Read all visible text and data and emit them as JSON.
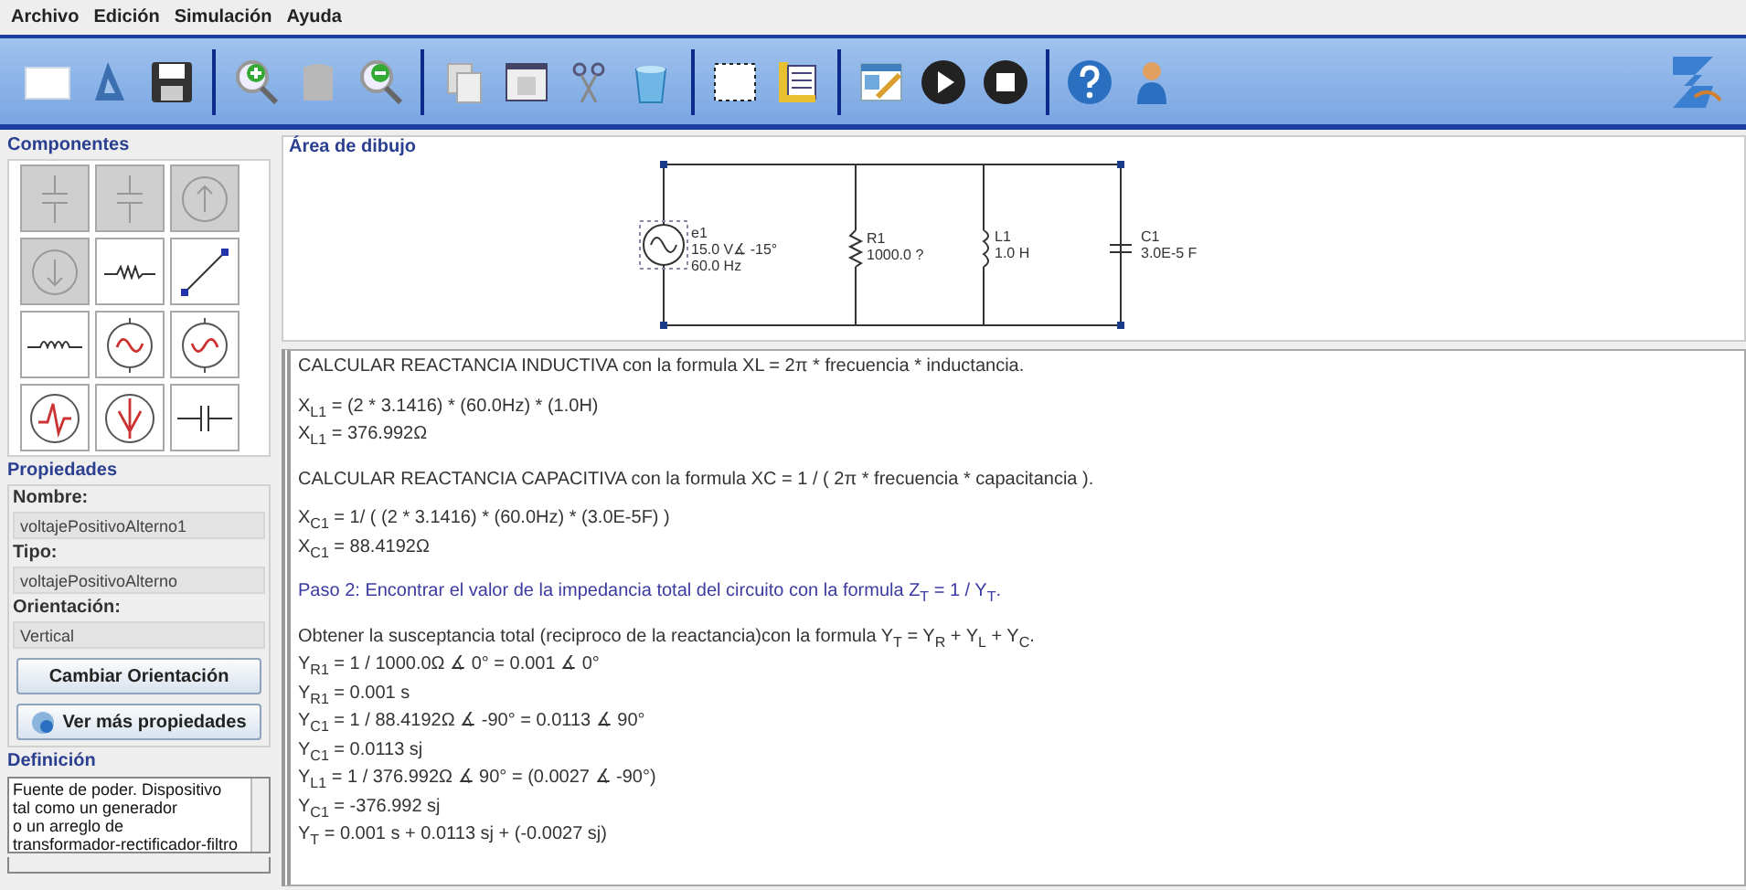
{
  "menu": [
    "Archivo",
    "Edición",
    "Simulación",
    "Ayuda"
  ],
  "components": {
    "title": "Componentes",
    "items": [
      {
        "kind": "capacitor",
        "disabled": true
      },
      {
        "kind": "capacitor",
        "disabled": true
      },
      {
        "kind": "source-up",
        "disabled": true
      },
      {
        "kind": "source-down",
        "disabled": true
      },
      {
        "kind": "resistor",
        "disabled": false
      },
      {
        "kind": "wire",
        "disabled": false
      },
      {
        "kind": "inductor",
        "disabled": false
      },
      {
        "kind": "ac-up",
        "disabled": false
      },
      {
        "kind": "ac-down",
        "disabled": false
      },
      {
        "kind": "pulse-up",
        "disabled": false
      },
      {
        "kind": "pulse-down",
        "disabled": false
      },
      {
        "kind": "cap-h",
        "disabled": false
      }
    ]
  },
  "properties": {
    "title": "Propiedades",
    "fields": [
      {
        "label": "Nombre:",
        "value": "voltajePositivoAlterno1"
      },
      {
        "label": "Tipo:",
        "value": "voltajePositivoAlterno"
      },
      {
        "label": "Orientación:",
        "value": "Vertical"
      }
    ],
    "buttons": [
      {
        "label": "Cambiar Orientación",
        "icon": false
      },
      {
        "label": "Ver más propiedades",
        "icon": true
      }
    ]
  },
  "definition": {
    "title": "Definición",
    "lines": [
      "Fuente de poder. Dispositivo",
      "tal como un generador",
      " o un arreglo de",
      "transformador-rectificador-filtro"
    ]
  },
  "drawing": {
    "title": "Área de dibujo",
    "source": [
      "e1",
      "15.0 V∡ -15°",
      "60.0 Hz"
    ],
    "resistor": [
      "R1",
      "1000.0 ?"
    ],
    "inductor": [
      "L1",
      "1.0 H"
    ],
    "capacitor": [
      "C1",
      "3.0E-5 F"
    ]
  },
  "output": [
    {
      "kind": "text",
      "lines": [
        "CALCULAR REACTANCIA INDUCTIVA con la formula XL = 2π * frecuencia * inductancia."
      ]
    },
    {
      "kind": "text",
      "lines": [
        "X$_{L1}$ = (2 * 3.1416) * (60.0Hz) * (1.0H)",
        "X$_{L1}$ = 376.992Ω"
      ]
    },
    {
      "kind": "text",
      "lines": [
        "CALCULAR REACTANCIA CAPACITIVA con la formula XC = 1 / ( 2π * frecuencia * capacitancia )."
      ]
    },
    {
      "kind": "text",
      "lines": [
        "X$_{C1}$ = 1/ ( (2 * 3.1416) * (60.0Hz) * (3.0E-5F) )",
        "X$_{C1}$ = 88.4192Ω"
      ]
    },
    {
      "kind": "step",
      "lines": [
        "Paso 2: Encontrar el valor de la impedancia total del circuito con la formula Z$_{T}$ = 1 / Y$_{T}$."
      ]
    },
    {
      "kind": "text",
      "lines": [
        "Obtener la susceptancia total (reciproco de la reactancia)con la formula Y$_{T}$ = Y$_{R}$ + Y$_{L}$ + Y$_{C}$.",
        "Y$_{R1}$ = 1 / 1000.0Ω ∡ 0° = 0.001 ∡ 0°",
        "Y$_{R1}$ = 0.001 s",
        "Y$_{C1}$ = 1 / 88.4192Ω ∡ -90° = 0.0113 ∡ 90°",
        "Y$_{C1}$ = 0.0113 sj",
        "Y$_{L1}$ = 1 / 376.992Ω ∡ 90° = (0.0027 ∡ -90°)",
        "Y$_{C1}$ = -376.992 sj",
        "Y$_{T}$ = 0.001 s + 0.0113 sj + (-0.0027 sj)"
      ]
    }
  ]
}
